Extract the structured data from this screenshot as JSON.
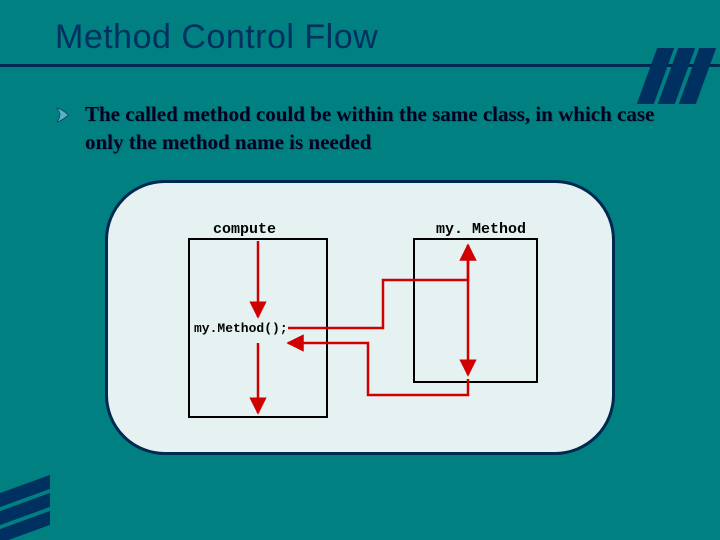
{
  "title": "Method Control Flow",
  "bullet": {
    "text": "The called method could be within the same class, in which case only the method name is needed"
  },
  "diagram": {
    "left_box_label": "compute",
    "right_box_label": "my. Method",
    "call_label": "my.Method();"
  },
  "colors": {
    "background": "#008080",
    "accent_dark": "#003060",
    "panel_bg": "#e6f2f2",
    "arrow": "#d00000"
  }
}
